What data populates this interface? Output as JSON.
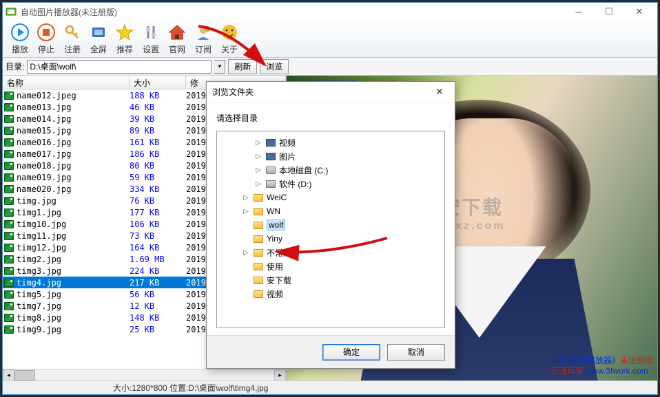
{
  "window": {
    "title": "自动图片播放器(未注册版)"
  },
  "toolbar": {
    "items": [
      {
        "label": "播放",
        "icon": "play"
      },
      {
        "label": "停止",
        "icon": "stop"
      },
      {
        "label": "注册",
        "icon": "key"
      },
      {
        "label": "全屏",
        "icon": "fullscreen"
      },
      {
        "label": "推荐",
        "icon": "star"
      },
      {
        "label": "设置",
        "icon": "settings"
      },
      {
        "label": "官网",
        "icon": "home"
      },
      {
        "label": "订阅",
        "icon": "subscribe"
      },
      {
        "label": "关于",
        "icon": "about"
      }
    ]
  },
  "pathbar": {
    "label": "目录:",
    "path": "D:\\桌面\\wolf\\",
    "refresh": "刷新",
    "browse": "浏览"
  },
  "file_header": {
    "name": "名称",
    "size": "大小",
    "mod": "修"
  },
  "files": [
    {
      "name": "name012.jpeg",
      "size": "188 KB",
      "mod": "2019"
    },
    {
      "name": "name013.jpg",
      "size": "46 KB",
      "mod": "2019"
    },
    {
      "name": "name014.jpg",
      "size": "39 KB",
      "mod": "2019"
    },
    {
      "name": "name015.jpg",
      "size": "89 KB",
      "mod": "2019"
    },
    {
      "name": "name016.jpg",
      "size": "161 KB",
      "mod": "2019"
    },
    {
      "name": "name017.jpg",
      "size": "186 KB",
      "mod": "2019"
    },
    {
      "name": "name018.jpg",
      "size": "80 KB",
      "mod": "2019"
    },
    {
      "name": "name019.jpg",
      "size": "59 KB",
      "mod": "2019"
    },
    {
      "name": "name020.jpg",
      "size": "334 KB",
      "mod": "2019"
    },
    {
      "name": "timg.jpg",
      "size": "76 KB",
      "mod": "2019"
    },
    {
      "name": "timg1.jpg",
      "size": "177 KB",
      "mod": "2019"
    },
    {
      "name": "timg10.jpg",
      "size": "106 KB",
      "mod": "2019"
    },
    {
      "name": "timg11.jpg",
      "size": "73 KB",
      "mod": "2019"
    },
    {
      "name": "timg12.jpg",
      "size": "164 KB",
      "mod": "2019"
    },
    {
      "name": "timg2.jpg",
      "size": "1.69 MB",
      "mod": "2019"
    },
    {
      "name": "timg3.jpg",
      "size": "224 KB",
      "mod": "2019"
    },
    {
      "name": "timg4.jpg",
      "size": "217 KB",
      "mod": "2019",
      "selected": true
    },
    {
      "name": "timg5.jpg",
      "size": "56 KB",
      "mod": "2019"
    },
    {
      "name": "timg7.jpg",
      "size": "12 KB",
      "mod": "2019"
    },
    {
      "name": "timg8.jpg",
      "size": "148 KB",
      "mod": "2019"
    },
    {
      "name": "timg9.jpg",
      "size": "25 KB",
      "mod": "2019"
    }
  ],
  "statusbar": {
    "text": "大小:1280*800 位置:D:\\桌面\\wolf\\timg4.jpg"
  },
  "preview": {
    "top_line1_a": "《自动图片播放器》",
    "top_line1_b": "未注册版",
    "top_line2_a": "三汪玩客 ",
    "top_line2_b": "www.3fwork.com",
    "wm_title": "安下载",
    "wm_sub": "anxz.com"
  },
  "dialog": {
    "title": "浏览文件夹",
    "prompt": "请选择目录",
    "ok": "确定",
    "cancel": "取消",
    "tree": [
      {
        "label": "视频",
        "indent": 2,
        "icon": "media",
        "exp": "▷"
      },
      {
        "label": "图片",
        "indent": 2,
        "icon": "media",
        "exp": "▷"
      },
      {
        "label": "本地磁盘 (C:)",
        "indent": 2,
        "icon": "drive",
        "exp": "▷"
      },
      {
        "label": "软件 (D:)",
        "indent": 2,
        "icon": "drive",
        "exp": "▷"
      },
      {
        "label": "WeiC",
        "indent": 1,
        "icon": "folder",
        "exp": "▷"
      },
      {
        "label": "WN",
        "indent": 1,
        "icon": "folder",
        "exp": "▷"
      },
      {
        "label": "wolf",
        "indent": 1,
        "icon": "folder",
        "exp": "",
        "selected": true
      },
      {
        "label": "Yiny",
        "indent": 1,
        "icon": "folder",
        "exp": ""
      },
      {
        "label": "不常用",
        "indent": 1,
        "icon": "folder",
        "exp": "▷"
      },
      {
        "label": "使用",
        "indent": 1,
        "icon": "folder",
        "exp": ""
      },
      {
        "label": "安下载",
        "indent": 1,
        "icon": "folder",
        "exp": ""
      },
      {
        "label": "视频",
        "indent": 1,
        "icon": "folder",
        "exp": ""
      }
    ]
  }
}
